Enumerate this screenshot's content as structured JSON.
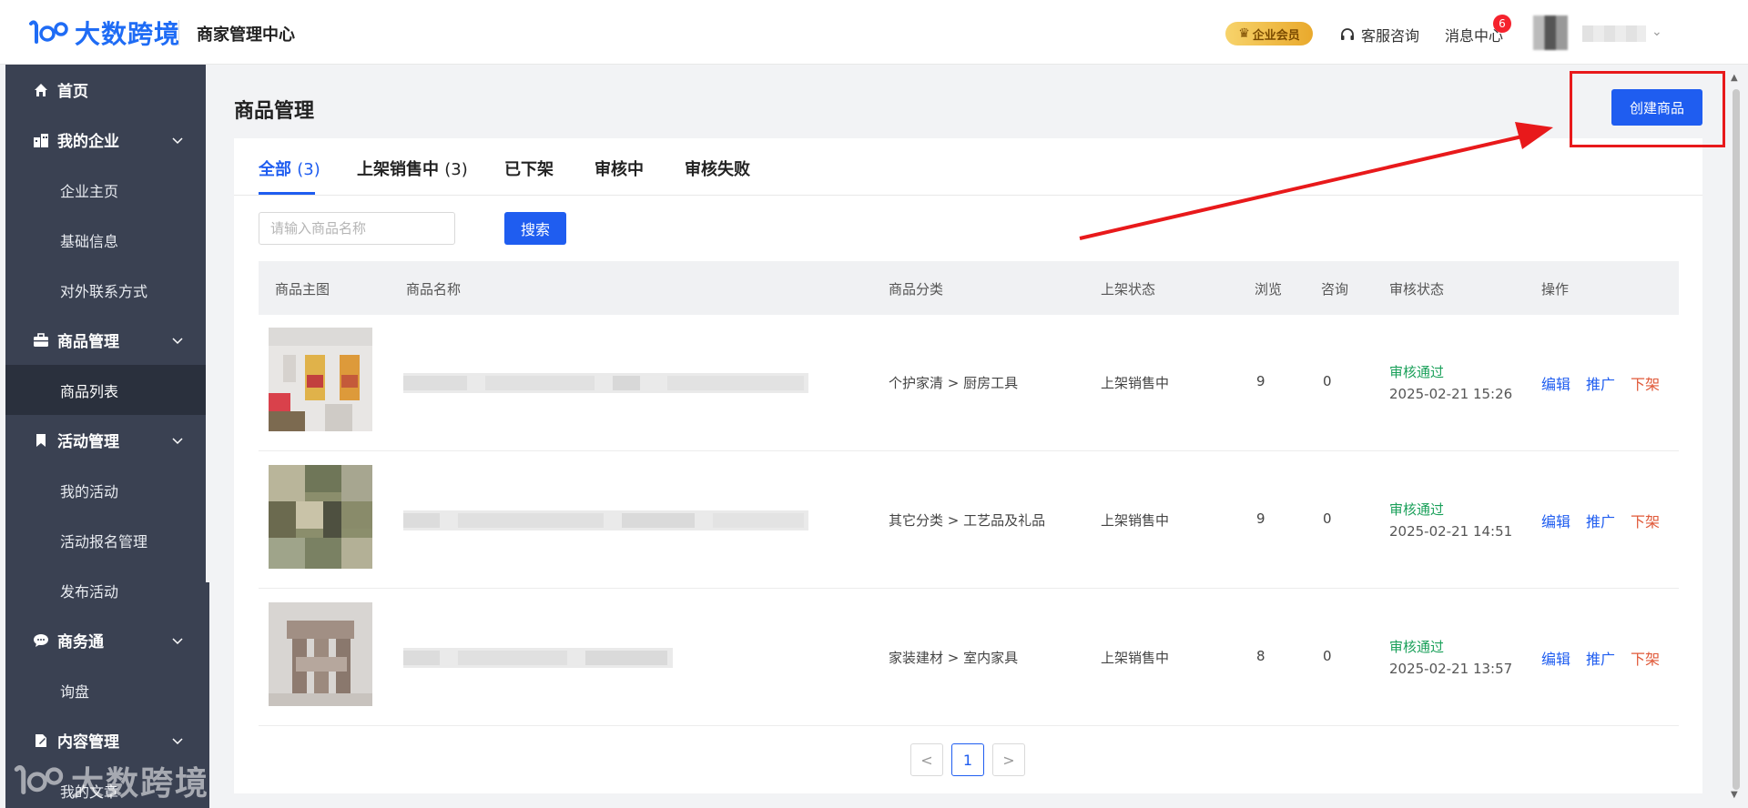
{
  "header": {
    "logo_text": "大数跨境",
    "title": "商家管理中心",
    "vip_label": "企业会员",
    "service_label": "客服咨询",
    "message_label": "消息中心",
    "message_count": "6"
  },
  "sidebar": {
    "items": [
      {
        "label": "首页",
        "icon": "home-icon"
      },
      {
        "label": "我的企业",
        "icon": "building-icon"
      },
      {
        "label": "企业主页"
      },
      {
        "label": "基础信息"
      },
      {
        "label": "对外联系方式"
      },
      {
        "label": "商品管理",
        "icon": "briefcase-icon"
      },
      {
        "label": "商品列表"
      },
      {
        "label": "活动管理",
        "icon": "bookmark-icon"
      },
      {
        "label": "我的活动"
      },
      {
        "label": "活动报名管理"
      },
      {
        "label": "发布活动"
      },
      {
        "label": "商务通",
        "icon": "chat-icon"
      },
      {
        "label": "询盘"
      },
      {
        "label": "内容管理",
        "icon": "document-icon"
      },
      {
        "label": "我的文章"
      }
    ],
    "watermark_text": "大数跨境"
  },
  "main": {
    "page_title": "商品管理",
    "create_button": "创建商品",
    "tabs": [
      {
        "label": "全部",
        "count": "(3)"
      },
      {
        "label": "上架销售中",
        "count": "(3)"
      },
      {
        "label": "已下架",
        "count": ""
      },
      {
        "label": "审核中",
        "count": ""
      },
      {
        "label": "审核失败",
        "count": ""
      }
    ],
    "search": {
      "placeholder": "请输入商品名称",
      "button": "搜索"
    },
    "table": {
      "columns": [
        "商品主图",
        "商品名称",
        "商品分类",
        "上架状态",
        "浏览",
        "咨询",
        "审核状态",
        "操作"
      ],
      "rows": [
        {
          "category": "个护家清 > 厨房工具",
          "listing_status": "上架销售中",
          "views": "9",
          "inquiries": "0",
          "review_status": "审核通过",
          "review_time": "2025-02-21 15:26",
          "actions": [
            "编辑",
            "推广",
            "下架"
          ]
        },
        {
          "category": "其它分类 > 工艺品及礼品",
          "listing_status": "上架销售中",
          "views": "9",
          "inquiries": "0",
          "review_status": "审核通过",
          "review_time": "2025-02-21 14:51",
          "actions": [
            "编辑",
            "推广",
            "下架"
          ]
        },
        {
          "category": "家装建材 > 室内家具",
          "listing_status": "上架销售中",
          "views": "8",
          "inquiries": "0",
          "review_status": "审核通过",
          "review_time": "2025-02-21 13:57",
          "actions": [
            "编辑",
            "推广",
            "下架"
          ]
        }
      ]
    },
    "pagination": {
      "prev": "<",
      "current": "1",
      "next": ">"
    }
  },
  "colors": {
    "accent": "#1f5df0",
    "sidebar": "#3a4152",
    "approved": "#1aa05a",
    "delist": "#e05a3a",
    "annotation": "#e8191b"
  }
}
